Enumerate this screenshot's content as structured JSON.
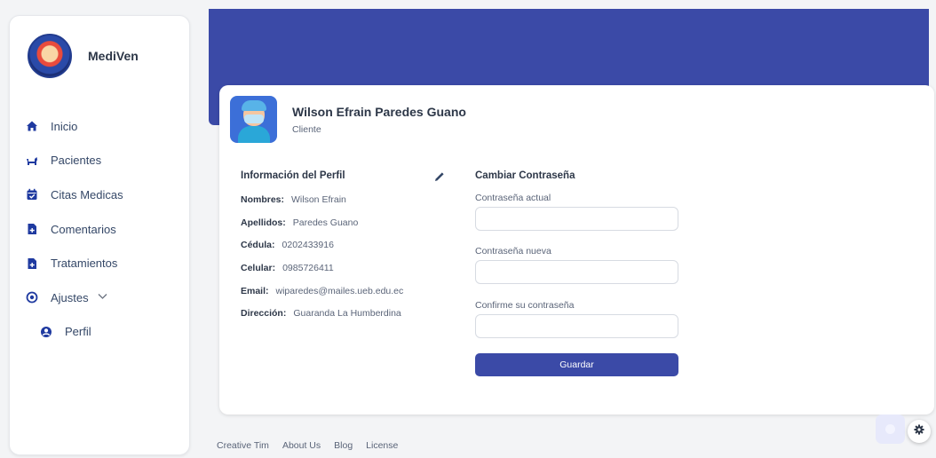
{
  "brand": {
    "name": "MediVen"
  },
  "sidebar": {
    "items": [
      {
        "label": "Inicio",
        "icon": "home-icon"
      },
      {
        "label": "Pacientes",
        "icon": "dog-icon"
      },
      {
        "label": "Citas Medicas",
        "icon": "calendar-check-icon"
      },
      {
        "label": "Comentarios",
        "icon": "file-plus-icon"
      },
      {
        "label": "Tratamientos",
        "icon": "file-plus-icon"
      },
      {
        "label": "Ajustes",
        "icon": "circle-dot-icon",
        "expanded": true
      },
      {
        "label": "Perfil",
        "icon": "user-circle-icon",
        "sub": true
      }
    ]
  },
  "profile": {
    "name": "Wilson Efrain Paredes Guano",
    "role": "Cliente"
  },
  "info": {
    "title": "Información del Perfil",
    "rows": [
      {
        "label": "Nombres:",
        "value": "Wilson Efrain"
      },
      {
        "label": "Apellidos:",
        "value": "Paredes Guano"
      },
      {
        "label": "Cédula:",
        "value": "0202433916"
      },
      {
        "label": "Celular:",
        "value": "0985726411"
      },
      {
        "label": "Email:",
        "value": "wiparedes@mailes.ueb.edu.ec"
      },
      {
        "label": "Dirección:",
        "value": "Guaranda La Humberdina"
      }
    ]
  },
  "password": {
    "title": "Cambiar Contraseña",
    "current_label": "Contraseña actual",
    "new_label": "Contraseña nueva",
    "confirm_label": "Confirme su contraseña",
    "current_value": "",
    "new_value": "",
    "confirm_value": "",
    "save_label": "Guardar"
  },
  "footer": {
    "links": [
      "Creative Tim",
      "About Us",
      "Blog",
      "License"
    ]
  },
  "colors": {
    "primary": "#3b4aa7",
    "icon_accent": "#1f3aa0"
  }
}
